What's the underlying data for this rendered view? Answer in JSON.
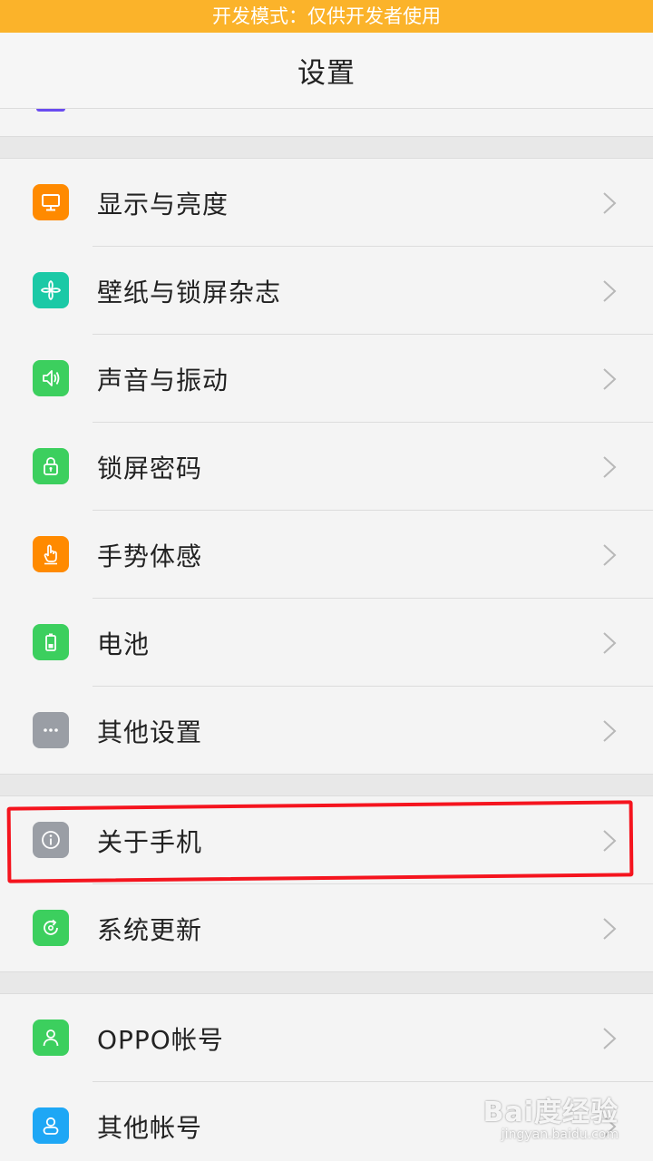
{
  "banner": {
    "text": "开发模式：仅供开发者使用"
  },
  "header": {
    "title": "设置"
  },
  "groups": [
    {
      "items": [
        {
          "label": "显示与亮度",
          "icon": "display-icon",
          "color": "#ff8a00"
        },
        {
          "label": "壁纸与锁屏杂志",
          "icon": "pinwheel-icon",
          "color": "#1bc9a6"
        },
        {
          "label": "声音与振动",
          "icon": "speaker-icon",
          "color": "#3ccf5e"
        },
        {
          "label": "锁屏密码",
          "icon": "lock-icon",
          "color": "#3ccf5e"
        },
        {
          "label": "手势体感",
          "icon": "gesture-hand-icon",
          "color": "#ff8a00"
        },
        {
          "label": "电池",
          "icon": "battery-icon",
          "color": "#3ccf5e"
        },
        {
          "label": "其他设置",
          "icon": "more-icon",
          "color": "#9a9ea5"
        }
      ]
    },
    {
      "items": [
        {
          "label": "关于手机",
          "icon": "info-icon",
          "color": "#9a9ea5"
        },
        {
          "label": "系统更新",
          "icon": "update-icon",
          "color": "#3ccf5e"
        }
      ]
    },
    {
      "items": [
        {
          "label": "OPPO帐号",
          "icon": "user-icon",
          "color": "#3ccf5e"
        },
        {
          "label": "其他帐号",
          "icon": "account-icon",
          "color": "#1ea7f5"
        }
      ]
    }
  ],
  "watermark": {
    "main": "Bai度经验",
    "sub": "jingyan.baidu.com"
  },
  "colors": {
    "banner": "#fbb32a",
    "highlight": "#f5141e"
  }
}
